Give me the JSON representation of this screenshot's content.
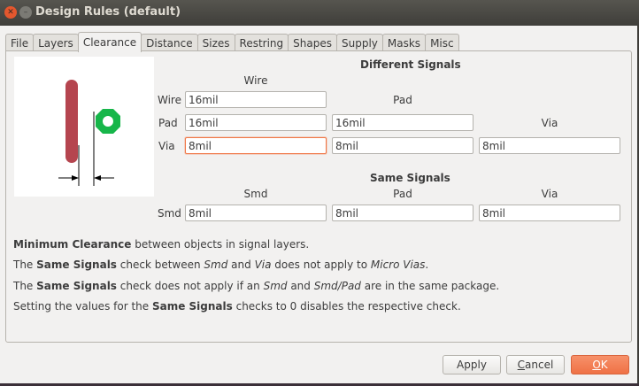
{
  "window": {
    "title": "Design Rules (default)",
    "close_glyph": "✕",
    "minimize_glyph": "–"
  },
  "tabs": [
    {
      "label": "File"
    },
    {
      "label": "Layers"
    },
    {
      "label": "Clearance",
      "active": true
    },
    {
      "label": "Distance"
    },
    {
      "label": "Sizes"
    },
    {
      "label": "Restring"
    },
    {
      "label": "Shapes"
    },
    {
      "label": "Supply"
    },
    {
      "label": "Masks"
    },
    {
      "label": "Misc"
    }
  ],
  "illustration": {
    "wire_color": "#b5454f",
    "via_color": "#17b64a"
  },
  "different_signals": {
    "title": "Different Signals",
    "col_wire": "Wire",
    "col_pad": "Pad",
    "col_via": "Via",
    "row_wire": "Wire",
    "row_pad": "Pad",
    "row_via": "Via",
    "wire_wire": "16mil",
    "pad_wire": "16mil",
    "pad_pad": "16mil",
    "via_wire": "8mil",
    "via_pad": "8mil",
    "via_via": "8mil"
  },
  "same_signals": {
    "title": "Same Signals",
    "col_smd": "Smd",
    "col_pad": "Pad",
    "col_via": "Via",
    "row_smd": "Smd",
    "smd_smd": "8mil",
    "smd_pad": "8mil",
    "smd_via": "8mil"
  },
  "info": {
    "line1": {
      "b1": "Minimum Clearance",
      "t1": " between objects in signal layers."
    },
    "line2": {
      "t1": "The ",
      "b1": "Same Signals",
      "t2": " check between ",
      "i1": "Smd",
      "t3": " and ",
      "i2": "Via",
      "t4": " does not apply to ",
      "i3": "Micro Vias",
      "t5": "."
    },
    "line3": {
      "t1": "The ",
      "b1": "Same Signals",
      "t2": " check does not apply if an ",
      "i1": "Smd",
      "t3": " and ",
      "i2": "Smd/Pad",
      "t4": " are in the same package."
    },
    "line4": {
      "t1": "Setting the values for the ",
      "b1": "Same Signals",
      "t2": " checks to 0 disables the respective check."
    }
  },
  "buttons": {
    "apply": "Apply",
    "cancel_first": "C",
    "cancel_rest": "ancel",
    "ok_first": "O",
    "ok_rest": "K"
  },
  "colors": {
    "accent": "#f07746",
    "titlebar": "#4a4944"
  }
}
